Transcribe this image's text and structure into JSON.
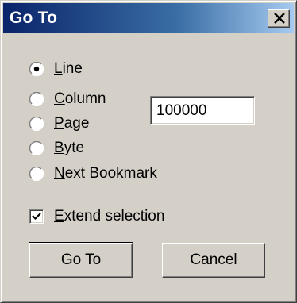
{
  "window": {
    "title": "Go To",
    "close_icon": "close-x-icon"
  },
  "options": [
    {
      "label_pre": "",
      "mnemonic": "L",
      "label_post": "ine",
      "selected": true
    },
    {
      "label_pre": "",
      "mnemonic": "C",
      "label_post": "olumn",
      "selected": false
    },
    {
      "label_pre": "",
      "mnemonic": "P",
      "label_post": "age",
      "selected": false
    },
    {
      "label_pre": "",
      "mnemonic": "B",
      "label_post": "yte",
      "selected": false
    },
    {
      "label_pre": "",
      "mnemonic": "N",
      "label_post": "ext Bookmark",
      "selected": false
    }
  ],
  "position_field": {
    "value_before_caret": "10000",
    "value_after_caret": "0"
  },
  "extend_selection": {
    "mnemonic": "E",
    "label_post": "xtend selection",
    "checked": true
  },
  "buttons": {
    "goto_label": "Go To",
    "cancel_label": "Cancel"
  }
}
